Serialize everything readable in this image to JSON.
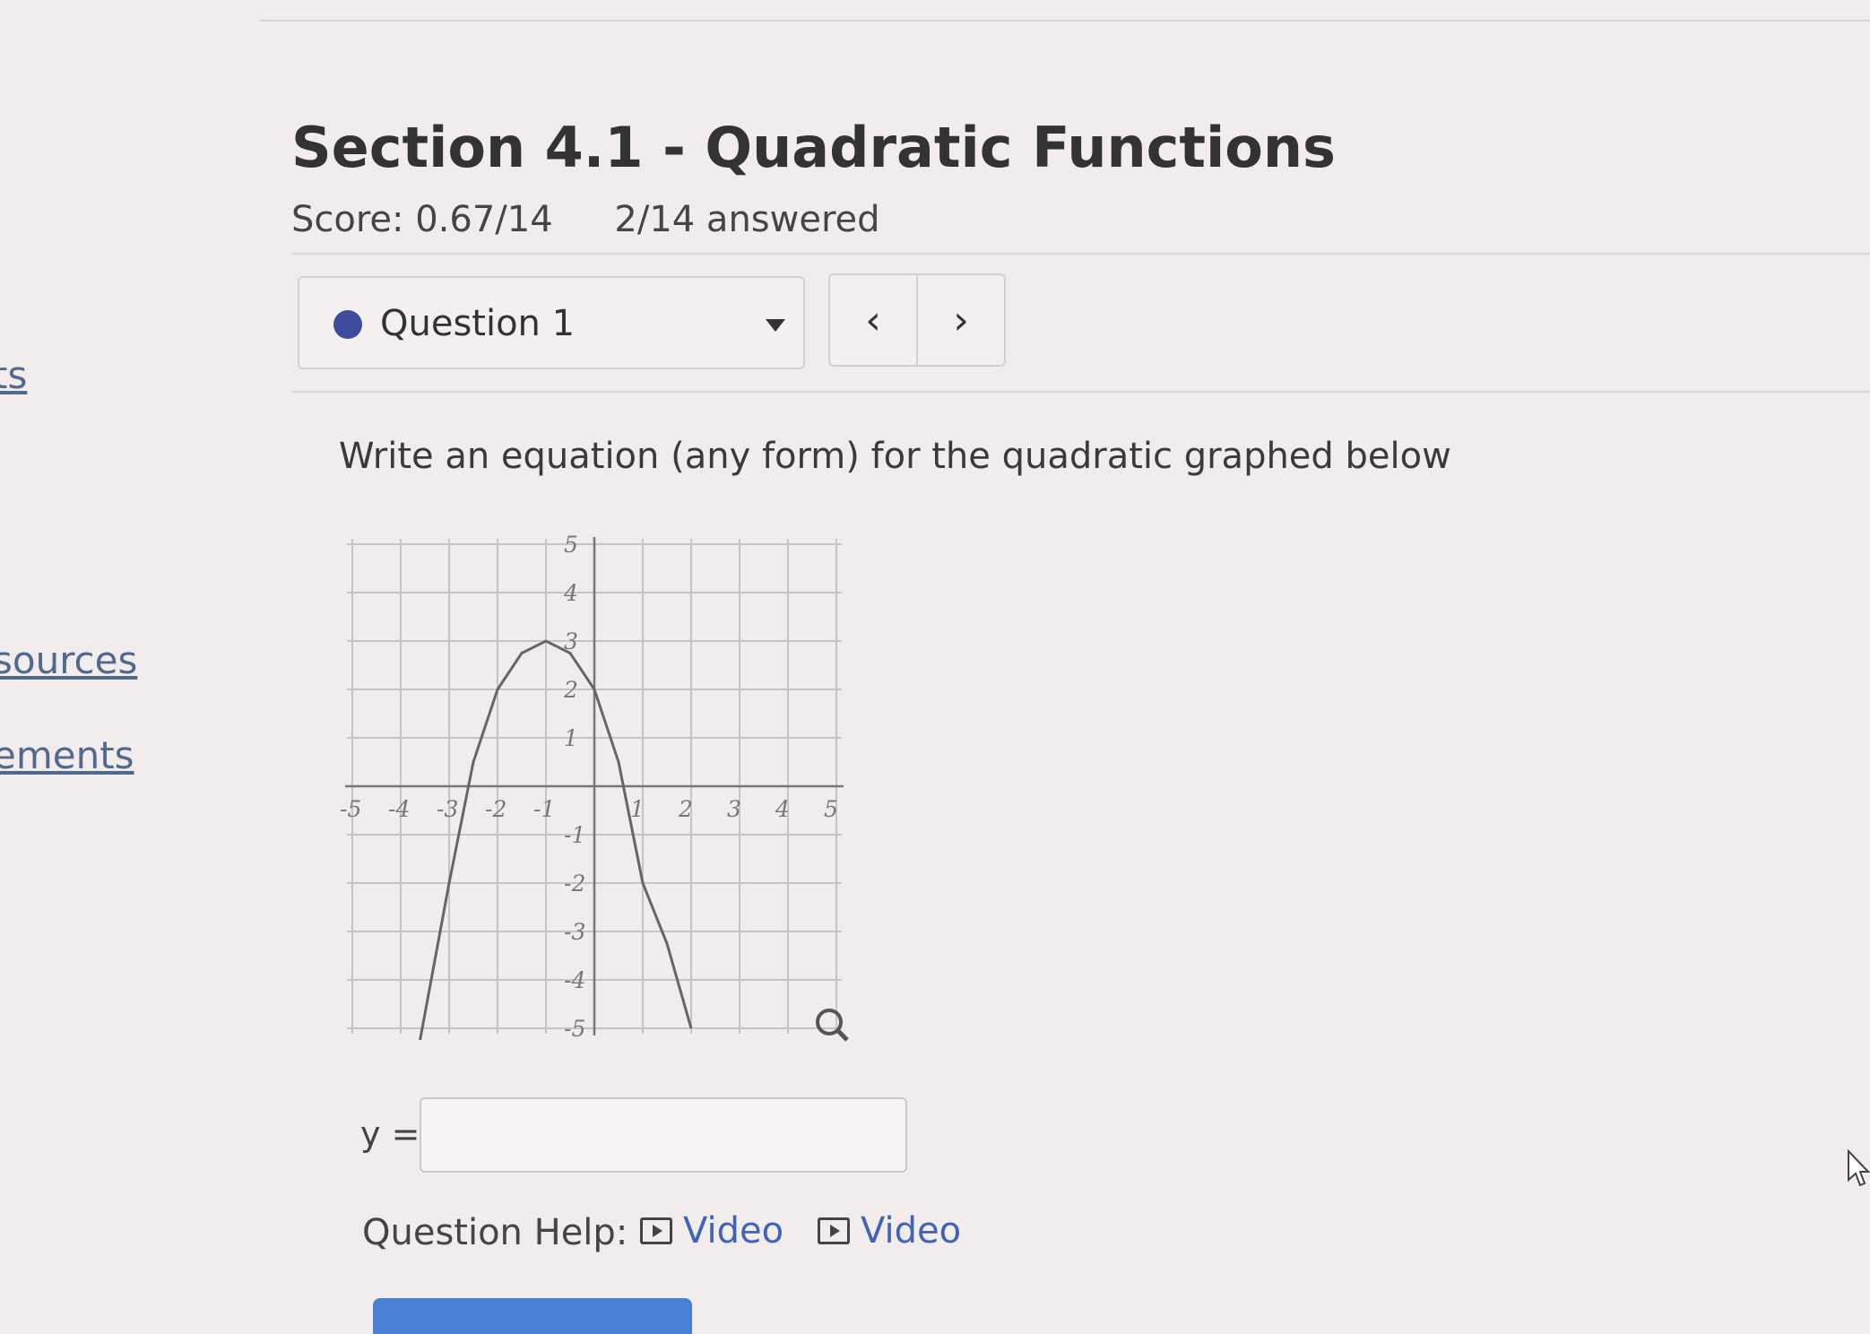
{
  "sidebar": {
    "links": [
      {
        "label": "ts"
      },
      {
        "label": "sources"
      },
      {
        "label": "ements"
      }
    ]
  },
  "header": {
    "title": "Section 4.1 - Quadratic Functions",
    "score": "Score: 0.67/14",
    "answered": "2/14 answered"
  },
  "question_select": {
    "label": "Question 1",
    "status_color": "#3e4c9c"
  },
  "nav": {
    "prev_icon": "‹",
    "next_icon": "›"
  },
  "question": {
    "prompt": "Write an equation (any form) for the quadratic graphed below",
    "answer_label": "y =",
    "answer_value": ""
  },
  "graph": {
    "x_ticks": [
      "-5",
      "-4",
      "-3",
      "-2",
      "-1",
      "1",
      "2",
      "3",
      "4",
      "5"
    ],
    "y_ticks": [
      "5",
      "4",
      "3",
      "2",
      "1",
      "-1",
      "-2",
      "-3",
      "-4",
      "-5"
    ],
    "zoom_icon": "magnifier-icon"
  },
  "help": {
    "label": "Question Help:",
    "links": [
      {
        "label": "Video",
        "icon": "play-icon"
      },
      {
        "label": "Video",
        "icon": "play-icon"
      }
    ]
  },
  "chart_data": {
    "type": "line",
    "title": "",
    "xlabel": "",
    "ylabel": "",
    "xlim": [
      -5,
      5
    ],
    "ylim": [
      -5,
      5
    ],
    "grid": true,
    "series": [
      {
        "x": [
          -3.6,
          -3,
          -2.5,
          -2,
          -1.5,
          -1,
          -0.5,
          0,
          0.5,
          1,
          1.5,
          2
        ],
        "y": [
          -5.24,
          -2,
          0.5,
          2,
          2.75,
          3,
          2.75,
          2,
          0.5,
          -2,
          -3.25,
          -5.0
        ],
        "color": "#666666"
      }
    ]
  }
}
